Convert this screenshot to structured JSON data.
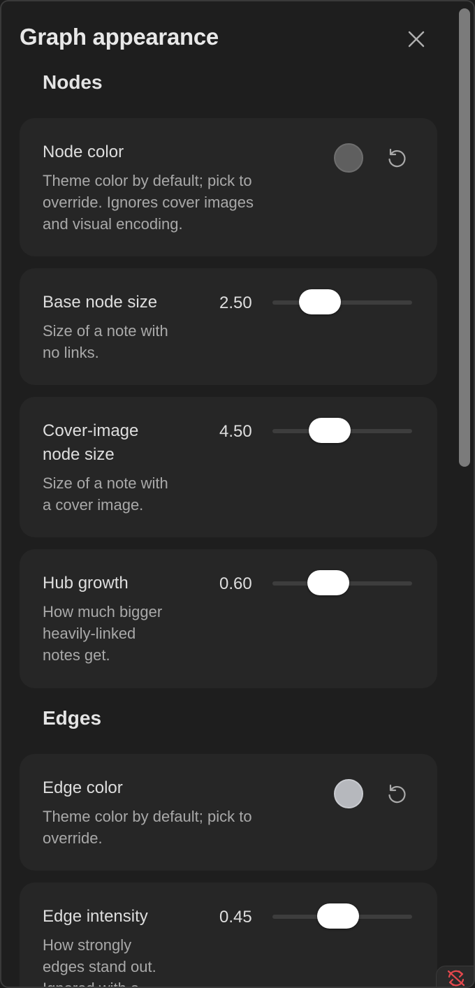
{
  "panel": {
    "title": "Graph appearance"
  },
  "colors": {
    "accent_error": "#e5484d",
    "node_swatch": "#5f5f5f",
    "edge_swatch": "#b6b8bd"
  },
  "icons": {
    "close": "close-icon",
    "reset": "reset-icon",
    "sync_error": "sync-error-icon"
  },
  "sections": {
    "nodes": "Nodes",
    "edges": "Edges"
  },
  "settings": {
    "node_color": {
      "name": "Node color",
      "desc_lines": [
        "Theme color by default; pick to",
        "override. Ignores cover images",
        "and visual encoding."
      ]
    },
    "base_node_size": {
      "name": "Base node size",
      "desc_lines": [
        "Size of a note with",
        "no links."
      ],
      "value": "2.50",
      "fraction": 0.27
    },
    "cover_image_node_size": {
      "name_lines": [
        "Cover-image",
        "node size"
      ],
      "desc_lines": [
        "Size of a note with",
        "a cover image."
      ],
      "value": "4.50",
      "fraction": 0.37
    },
    "hub_growth": {
      "name": "Hub growth",
      "desc_lines": [
        "How much bigger",
        "heavily-linked",
        "notes get."
      ],
      "value": "0.60",
      "fraction": 0.36
    },
    "edge_color": {
      "name": "Edge color",
      "desc_lines": [
        "Theme color by default; pick to",
        "override."
      ]
    },
    "edge_intensity": {
      "name": "Edge intensity",
      "desc_lines": [
        "How strongly",
        "edges stand out.",
        "Ignored with a"
      ],
      "value": "0.45",
      "fraction": 0.46
    }
  }
}
